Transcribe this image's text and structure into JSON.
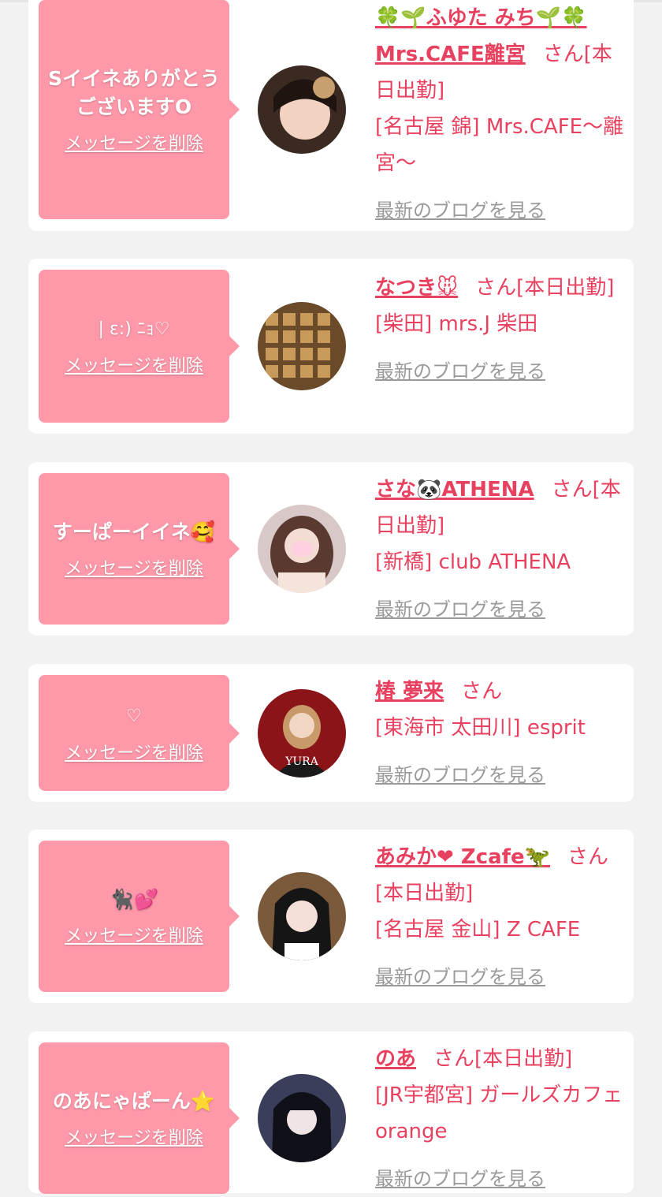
{
  "delete_label": "メッセージを削除",
  "blog_label": "最新のブログを見る",
  "colors": {
    "accent": "#e8415f",
    "bubble": "#ff99aa",
    "background": "#f2f2f2"
  },
  "items": [
    {
      "message": "SイイネありがとうございますO",
      "name": "🍀🌱ふゆた みち🌱🍀Mrs.CAFE離宮",
      "san": "さん[本日出勤]",
      "shop": "[名古屋 錦] Mrs.CAFE～離宮～",
      "avatar_icon": "avatar-photo"
    },
    {
      "message": "| ε:) ﾆｮ♡",
      "name": "なつき🐭",
      "san": "さん[本日出勤]",
      "shop": "[柴田] mrs.J 柴田",
      "avatar_icon": "avatar-photo"
    },
    {
      "message": "すーぱーイイネ🥰",
      "name": "さな🐼ATHENA",
      "san": "さん[本日出勤]",
      "shop": "[新橋] club ATHENA",
      "avatar_icon": "avatar-photo"
    },
    {
      "message": "♡",
      "name": "椿 夢来",
      "san": "さん",
      "shop": "[東海市 太田川] esprit",
      "avatar_icon": "avatar-photo"
    },
    {
      "message": "🐈‍⬛💕",
      "name": "あみか❤ Zcafe🦖",
      "san": "さん[本日出勤]",
      "shop": "[名古屋 金山] Z CAFE",
      "avatar_icon": "avatar-photo"
    },
    {
      "message": "のあにゃぱーん⭐",
      "name": "のあ",
      "san": "さん[本日出勤]",
      "shop": "[JR宇都宮] ガールズカフェ orange",
      "avatar_icon": "avatar-photo"
    }
  ]
}
